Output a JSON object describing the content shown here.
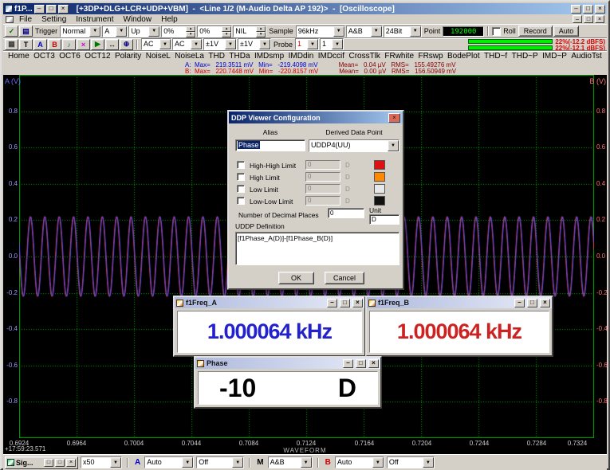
{
  "titlebar": {
    "mini_title": "f1P...",
    "title": "[+3DP+DLG+LCR+UDP+VBM]  -  <Line 1/2 (M-Audio Delta AP 192)>  -  [Oscilloscope]"
  },
  "menu": {
    "items": [
      "File",
      "Setting",
      "Instrument",
      "Window",
      "Help"
    ]
  },
  "glyphs": {
    "dropdown": "▼",
    "spin_up": "▴",
    "spin_down": "▾",
    "minimize": "–",
    "maximize": "□",
    "restore": "□",
    "close": "×"
  },
  "icons": {
    "toolbar1": [
      {
        "name": "confirm-icon",
        "glyph": "✓",
        "color": "#007700"
      },
      {
        "name": "panel-icon",
        "glyph": "▤",
        "color": "#000080"
      }
    ],
    "toolbar2": [
      {
        "name": "grid-icon",
        "glyph": "▦",
        "color": "#404040"
      },
      {
        "name": "text-label-icon",
        "glyph": "T",
        "color": "#000000"
      },
      {
        "name": "marker-a-icon",
        "glyph": "A",
        "color": "#0000cc"
      },
      {
        "name": "marker-b-icon",
        "glyph": "B",
        "color": "#cc0000"
      },
      {
        "name": "notes-icon",
        "glyph": "♪",
        "color": "#008080"
      },
      {
        "name": "delete-icon",
        "glyph": "×",
        "color": "#cc00cc"
      },
      {
        "name": "play-icon",
        "glyph": "▶",
        "color": "#007700"
      },
      {
        "name": "pan-icon",
        "glyph": "↔",
        "color": "#000000"
      },
      {
        "name": "zoom-icon",
        "glyph": "⊕",
        "color": "#000080"
      }
    ]
  },
  "toolbar1": {
    "trigger_label": "Trigger",
    "mode": "Normal",
    "source": "A",
    "edge": "Up",
    "level": "0%",
    "hysteresis": "0%",
    "holdoff": "NIL",
    "sample_label": "Sample",
    "rate": "96kHz",
    "channels": "A&B",
    "bits": "24Bit",
    "point_label": "Point",
    "points": "192000",
    "roll_label": "Roll",
    "record_label": "Record",
    "auto_label": "Auto"
  },
  "toolbar2": {
    "coupling_a": "AC",
    "coupling_b": "AC",
    "range_a": "±1V",
    "range_b": "±1V",
    "probe_label": "Probe",
    "probe_a": "1",
    "probe_b": "1",
    "level_a": "22%(-12.2 dBFS)",
    "level_b": "22%(-12.1 dBFS)",
    "meter_color": "#00ee00"
  },
  "tabs": [
    "Home",
    "OCT3",
    "OCT6",
    "OCT12",
    "Polarity",
    "NoiseL",
    "NoiseLa",
    "THD",
    "THDa",
    "IMDsmp",
    "IMDdin",
    "IMDccif",
    "CrossTlk",
    "FRwhite",
    "FRswp",
    "BodePlot",
    "THD~f",
    "THD~P",
    "IMD~P",
    "AudioTst"
  ],
  "stats": {
    "a_main": "A:  Max=   219.3511 mV   Min=   -219.4098 mV",
    "a_extra": "Mean=   0.04 µV   RMS=   155.49276 mV",
    "b_main": "B:  Max=   220.7448 mV   Min=   -220.8157 mV",
    "b_extra": "Mean=   0.00 µV   RMS=   156.50949 mV"
  },
  "chart": {
    "type": "line",
    "title": "WAVEFORM",
    "corner_label_left": "A (V)",
    "corner_label_right": "B (V)",
    "timestamp": "+17:59:23.571",
    "x_range": [
      0.6924,
      0.7324
    ],
    "y_range": [
      -1,
      1
    ],
    "x_ticks": [
      "0.6924",
      "0.6964",
      "0.7004",
      "0.7044",
      "0.7084",
      "0.7124",
      "0.7164",
      "0.7204",
      "0.7244",
      "0.7284",
      "0.7324"
    ],
    "y_ticks": [
      "0.8",
      "0.6",
      "0.4",
      "0.2",
      "0.0",
      "-0.2",
      "-0.4",
      "-0.6",
      "-0.8"
    ],
    "grid_color": "#00aa00",
    "bg_color": "#000000",
    "series": [
      {
        "name": "B",
        "color": "#ff3333",
        "amplitude_v": 0.2207,
        "frequency_hz": 1000.064,
        "phase_deg": 10
      },
      {
        "name": "A",
        "color": "#5555ff",
        "amplitude_v": 0.2194,
        "frequency_hz": 1000.064,
        "phase_deg": 0
      }
    ]
  },
  "dialog": {
    "title": "DDP Viewer Configuration",
    "alias_label": "Alias",
    "ddp_label": "Derived Data Point",
    "alias_value": "Phase",
    "ddp_value": "UDDP4(UU)",
    "limits": [
      {
        "label": "High-High Limit",
        "value": "0",
        "unit": "D",
        "color": "#dd1111"
      },
      {
        "label": "High Limit",
        "value": "0",
        "unit": "D",
        "color": "#ff8800"
      },
      {
        "label": "Low Limit",
        "value": "0",
        "unit": "D",
        "color": "#e8e8e8"
      },
      {
        "label": "Low-Low Limit",
        "value": "0",
        "unit": "D",
        "color": "#111111"
      }
    ],
    "decimal_label": "Number of Decimal Places",
    "decimal_value": "0",
    "uddp_label": "UDDP Definition",
    "unit_label": "Unit",
    "unit_value": "D",
    "definition": "[f1Phase_A(D)]-[f1Phase_B(D)]",
    "ok_label": "OK",
    "cancel_label": "Cancel"
  },
  "meters": {
    "freq_a": {
      "title": "f1Freq_A",
      "value": "1.000064 kHz",
      "color": "#2222cc"
    },
    "freq_b": {
      "title": "f1Freq_B",
      "value": "1.000064 kHz",
      "color": "#cc2222"
    },
    "phase": {
      "title": "Phase",
      "value": "-10",
      "unit": "D",
      "color": "#000000"
    }
  },
  "bottombar": {
    "mini_title": "Sig...",
    "zoom": "x50",
    "a_label": "A",
    "a_mode": "Auto",
    "a_filter": "Off",
    "m_label": "M",
    "m_mode": "A&B",
    "b_label": "B",
    "b_mode": "Auto",
    "b_filter": "Off"
  }
}
